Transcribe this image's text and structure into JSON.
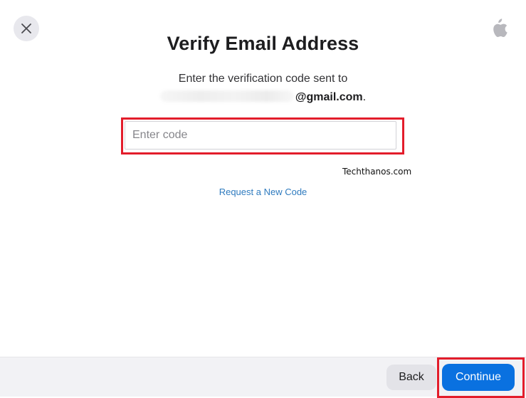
{
  "header": {
    "close_icon": "close-icon",
    "logo_icon": "apple-logo-icon"
  },
  "dialog": {
    "title": "Verify Email Address",
    "instruction": "Enter the verification code sent to",
    "email_domain": "@gmail.com",
    "email_suffix": "."
  },
  "code_input": {
    "placeholder": "Enter code",
    "value": ""
  },
  "watermark": "Techthanos.com",
  "request_link": "Request a New Code",
  "footer": {
    "back_label": "Back",
    "continue_label": "Continue"
  },
  "colors": {
    "highlight": "#e31d2b",
    "primary": "#0a71e0",
    "link": "#2f7bbf",
    "footer_bg": "#f2f2f5"
  }
}
